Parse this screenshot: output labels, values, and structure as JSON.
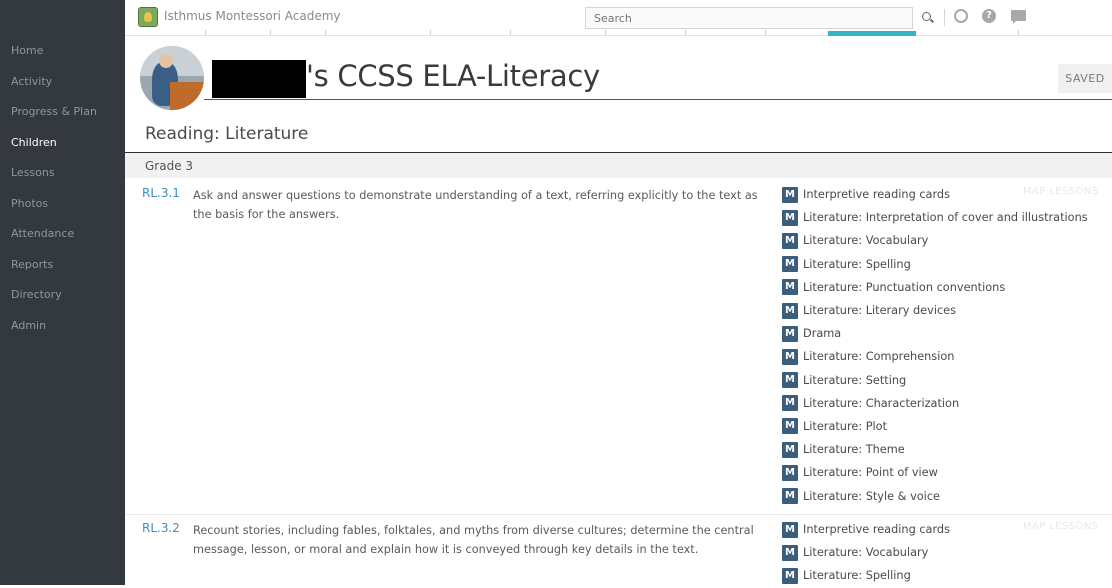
{
  "app": {
    "title": "Isthmus Montessori Academy",
    "search_placeholder": "Search"
  },
  "icons": {
    "help": "?",
    "m_badge": "M",
    "names": [
      "logo-icon",
      "search-icon",
      "globe-icon",
      "help-icon",
      "chat-icon"
    ]
  },
  "colors": {
    "sidebar": "#33393f",
    "accent": "#35b7c3",
    "link": "#3f8ec4",
    "badge": "#3b5e7c"
  },
  "sidebar": {
    "items": [
      {
        "label": "Home",
        "active": false
      },
      {
        "label": "Activity",
        "active": false
      },
      {
        "label": "Progress & Plan",
        "active": false
      },
      {
        "label": "Children",
        "active": true
      },
      {
        "label": "Lessons",
        "active": false
      },
      {
        "label": "Photos",
        "active": false
      },
      {
        "label": "Attendance",
        "active": false
      },
      {
        "label": "Reports",
        "active": false
      },
      {
        "label": "Directory",
        "active": false
      },
      {
        "label": "Admin",
        "active": false
      }
    ]
  },
  "header": {
    "title": "'s CCSS ELA-Literacy",
    "saved_label": "SAVED"
  },
  "section": {
    "heading": "Reading: Literature",
    "grade": "Grade 3"
  },
  "standards": [
    {
      "code": "RL.3.1",
      "description": "Ask and answer questions to demonstrate understanding of a text, referring explicitly to the text as the basis for the answers.",
      "map_label": "MAP LESSONS",
      "lessons": [
        "Interpretive reading cards",
        "Literature: Interpretation of cover and illustrations",
        "Literature: Vocabulary",
        "Literature: Spelling",
        "Literature: Punctuation conventions",
        "Literature: Literary devices",
        "Drama",
        "Literature: Comprehension",
        "Literature: Setting",
        "Literature: Characterization",
        "Literature: Plot",
        "Literature: Theme",
        "Literature: Point of view",
        "Literature: Style & voice"
      ]
    },
    {
      "code": "RL.3.2",
      "description": "Recount stories, including fables, folktales, and myths from diverse cultures; determine the central message, lesson, or moral and explain how it is conveyed through key details in the text.",
      "map_label": "MAP LESSONS",
      "lessons": [
        "Interpretive reading cards",
        "Literature: Vocabulary",
        "Literature: Spelling"
      ]
    }
  ]
}
